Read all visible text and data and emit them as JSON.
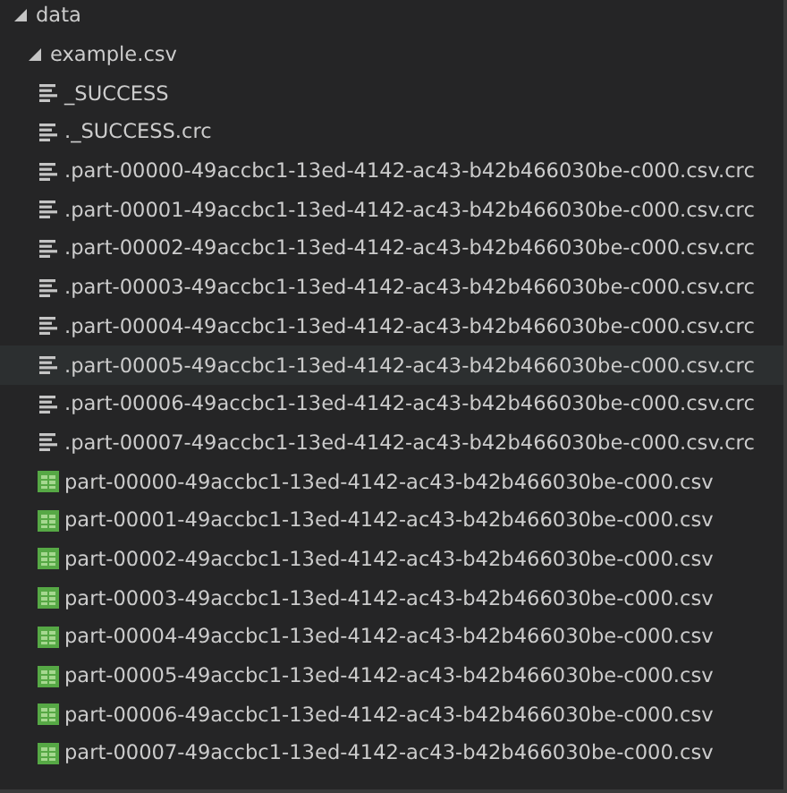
{
  "tree": [
    {
      "label": "data",
      "expanded": true,
      "children": [
        {
          "label": "example.csv",
          "expanded": true,
          "children": [
            {
              "label": "_SUCCESS",
              "kind": "text",
              "hovered": false
            },
            {
              "label": "._SUCCESS.crc",
              "kind": "text",
              "hovered": false
            },
            {
              "label": ".part-00000-49accbc1-13ed-4142-ac43-b42b466030be-c000.csv.crc",
              "kind": "text",
              "hovered": false
            },
            {
              "label": ".part-00001-49accbc1-13ed-4142-ac43-b42b466030be-c000.csv.crc",
              "kind": "text",
              "hovered": false
            },
            {
              "label": ".part-00002-49accbc1-13ed-4142-ac43-b42b466030be-c000.csv.crc",
              "kind": "text",
              "hovered": false
            },
            {
              "label": ".part-00003-49accbc1-13ed-4142-ac43-b42b466030be-c000.csv.crc",
              "kind": "text",
              "hovered": false
            },
            {
              "label": ".part-00004-49accbc1-13ed-4142-ac43-b42b466030be-c000.csv.crc",
              "kind": "text",
              "hovered": false
            },
            {
              "label": ".part-00005-49accbc1-13ed-4142-ac43-b42b466030be-c000.csv.crc",
              "kind": "text",
              "hovered": true
            },
            {
              "label": ".part-00006-49accbc1-13ed-4142-ac43-b42b466030be-c000.csv.crc",
              "kind": "text",
              "hovered": false
            },
            {
              "label": ".part-00007-49accbc1-13ed-4142-ac43-b42b466030be-c000.csv.crc",
              "kind": "text",
              "hovered": false
            },
            {
              "label": "part-00000-49accbc1-13ed-4142-ac43-b42b466030be-c000.csv",
              "kind": "csv",
              "hovered": false
            },
            {
              "label": "part-00001-49accbc1-13ed-4142-ac43-b42b466030be-c000.csv",
              "kind": "csv",
              "hovered": false
            },
            {
              "label": "part-00002-49accbc1-13ed-4142-ac43-b42b466030be-c000.csv",
              "kind": "csv",
              "hovered": false
            },
            {
              "label": "part-00003-49accbc1-13ed-4142-ac43-b42b466030be-c000.csv",
              "kind": "csv",
              "hovered": false
            },
            {
              "label": "part-00004-49accbc1-13ed-4142-ac43-b42b466030be-c000.csv",
              "kind": "csv",
              "hovered": false
            },
            {
              "label": "part-00005-49accbc1-13ed-4142-ac43-b42b466030be-c000.csv",
              "kind": "csv",
              "hovered": false
            },
            {
              "label": "part-00006-49accbc1-13ed-4142-ac43-b42b466030be-c000.csv",
              "kind": "csv",
              "hovered": false
            },
            {
              "label": "part-00007-49accbc1-13ed-4142-ac43-b42b466030be-c000.csv",
              "kind": "csv",
              "hovered": false
            }
          ]
        }
      ]
    }
  ]
}
